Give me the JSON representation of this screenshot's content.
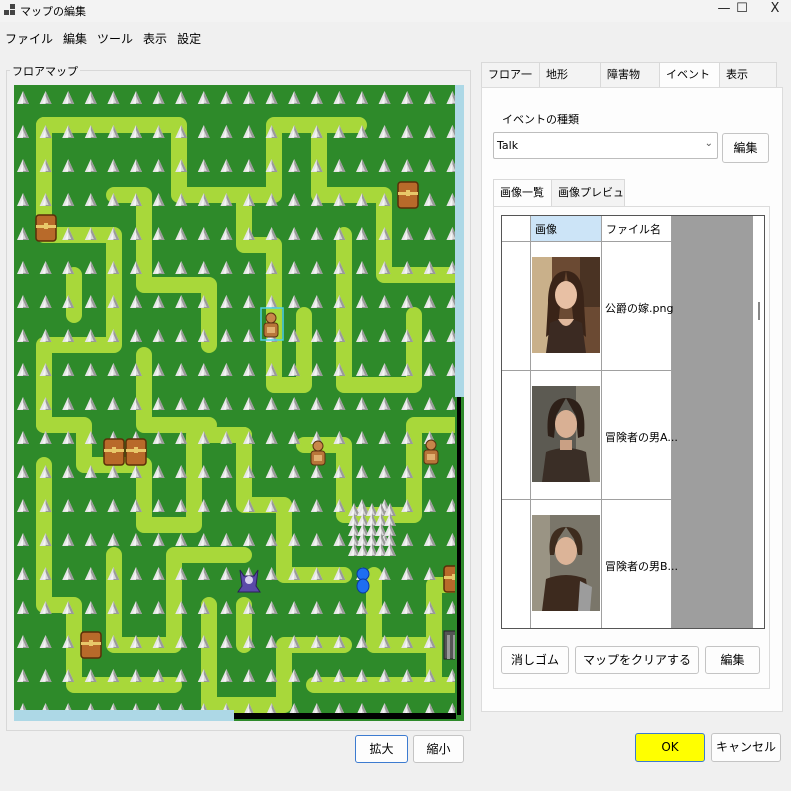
{
  "window": {
    "title": "マップの編集",
    "controls": {
      "minimize": "—",
      "maximize": "☐",
      "close": "X"
    }
  },
  "menu": [
    "ファイル",
    "編集",
    "ツール",
    "表示",
    "設定"
  ],
  "floor_map": {
    "legend": "フロアマップ",
    "zoom_in_label": "拡大",
    "zoom_out_label": "縮小",
    "map_icons": [
      "tree-tile",
      "path-tile",
      "treasure-chest-icon",
      "npc-statue-icon",
      "demon-player-icon",
      "blue-crystal-icon",
      "iron-gate-icon"
    ]
  },
  "tabs": [
    "フロア一覧",
    "地形",
    "障害物",
    "イベント",
    "表示"
  ],
  "active_tab": "イベント",
  "event_panel": {
    "type_label": "イベントの種類",
    "type_value": "Talk",
    "edit_button": "編集",
    "subtabs": [
      "画像一覧",
      "画像プレビュー"
    ],
    "active_subtab": "画像一覧",
    "grid": {
      "headers": [
        "画像",
        "ファイル名"
      ],
      "rows": [
        {
          "file": "公爵の嫁.png"
        },
        {
          "file": "冒険者の男A..."
        },
        {
          "file": "冒険者の男B..."
        }
      ]
    },
    "buttons": {
      "eraser": "消しゴム",
      "clear_map": "マップをクリアする",
      "edit": "編集"
    }
  },
  "footer": {
    "ok": "OK",
    "cancel": "キャンセル"
  },
  "colors": {
    "grass": "#2e8a2a",
    "path": "#a8d83a",
    "scroll_thumb": "#add8e6",
    "ok_button": "#ffff00",
    "grid_background": "#9e9e9e"
  }
}
